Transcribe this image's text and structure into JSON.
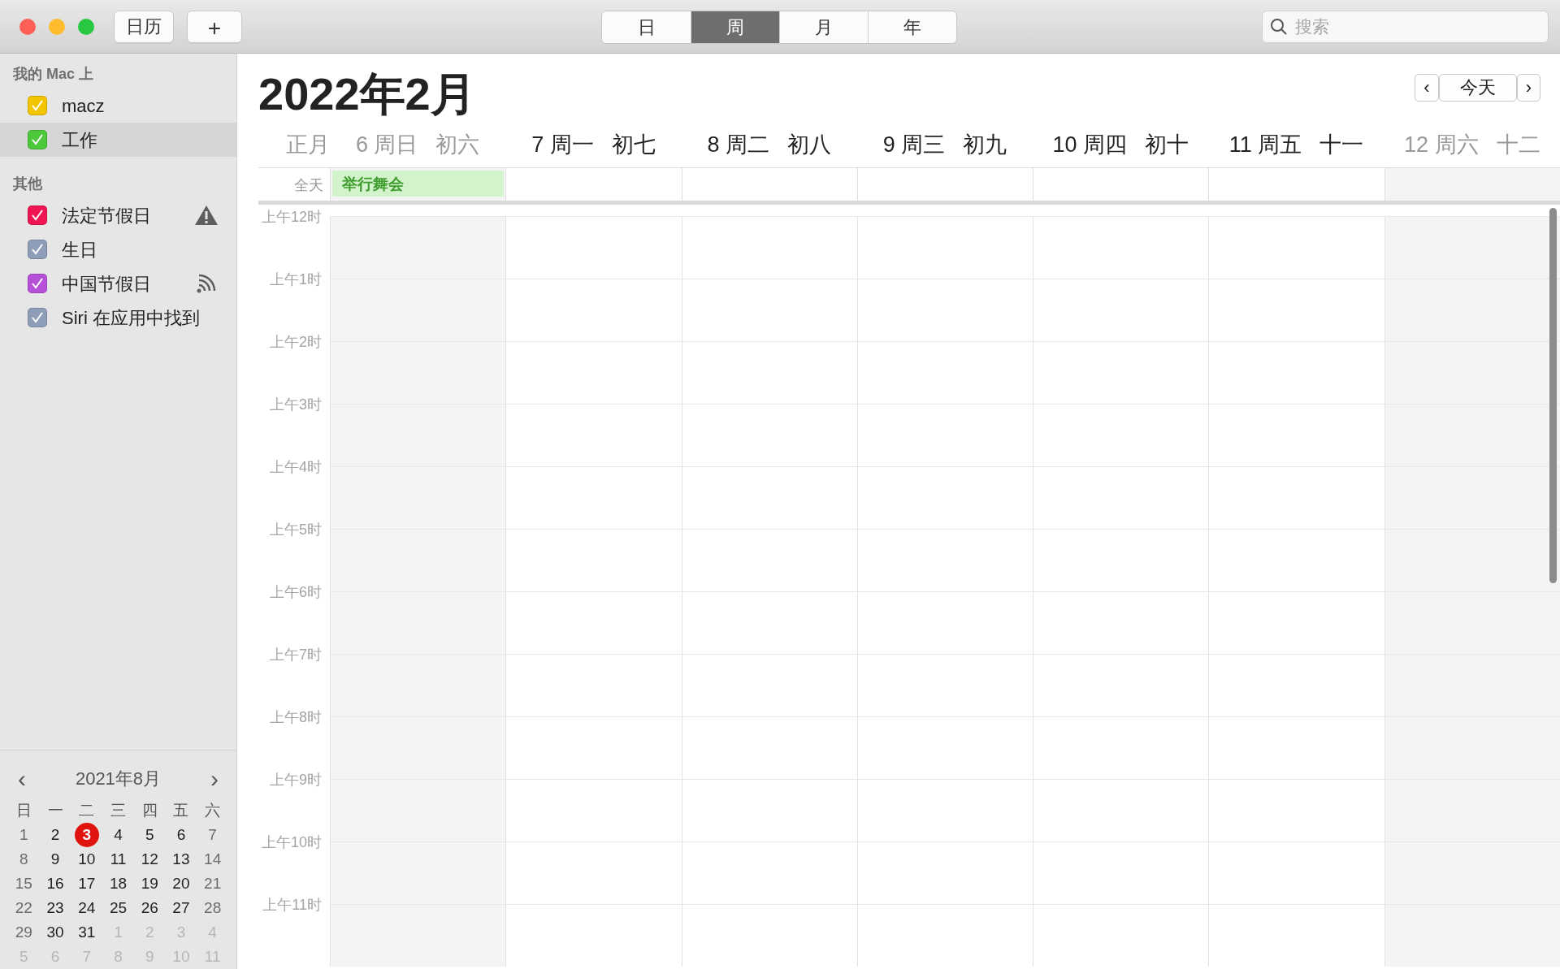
{
  "toolbar": {
    "calendars_button": "日历",
    "add_button": "+",
    "views": [
      {
        "label": "日",
        "selected": false
      },
      {
        "label": "周",
        "selected": true
      },
      {
        "label": "月",
        "selected": false
      },
      {
        "label": "年",
        "selected": false
      }
    ],
    "search": {
      "placeholder": "搜索"
    }
  },
  "sidebar": {
    "groups": [
      {
        "title": "我的 Mac 上",
        "items": [
          {
            "name": "macz",
            "color": "#f2c500",
            "checked": true,
            "selected": false,
            "alert": false,
            "subscribed": false
          },
          {
            "name": "工作",
            "color": "#4cc83a",
            "checked": true,
            "selected": true,
            "alert": false,
            "subscribed": false
          }
        ]
      },
      {
        "title": "其他",
        "items": [
          {
            "name": "法定节假日",
            "color": "#ef1552",
            "checked": true,
            "selected": false,
            "alert": true,
            "subscribed": false
          },
          {
            "name": "生日",
            "color": "#8e9db8",
            "checked": true,
            "selected": false,
            "alert": false,
            "subscribed": false
          },
          {
            "name": "中国节假日",
            "color": "#b650d8",
            "checked": true,
            "selected": false,
            "alert": false,
            "subscribed": true
          },
          {
            "name": "Siri 在应用中找到",
            "color": "#8e9db8",
            "checked": true,
            "selected": false,
            "alert": false,
            "subscribed": false
          }
        ]
      }
    ]
  },
  "mini_calendar": {
    "prev": "‹",
    "title": "2021年8月",
    "next": "›",
    "weekdays": [
      "日",
      "一",
      "二",
      "三",
      "四",
      "五",
      "六"
    ],
    "weeks": [
      [
        {
          "day": "1",
          "other_month": false,
          "today": false
        },
        {
          "day": "2",
          "other_month": false,
          "today": false
        },
        {
          "day": "3",
          "other_month": false,
          "today": true
        },
        {
          "day": "4",
          "other_month": false,
          "today": false
        },
        {
          "day": "5",
          "other_month": false,
          "today": false
        },
        {
          "day": "6",
          "other_month": false,
          "today": false
        },
        {
          "day": "7",
          "other_month": false,
          "today": false
        }
      ],
      [
        {
          "day": "8",
          "other_month": false,
          "today": false
        },
        {
          "day": "9",
          "other_month": false,
          "today": false
        },
        {
          "day": "10",
          "other_month": false,
          "today": false
        },
        {
          "day": "11",
          "other_month": false,
          "today": false
        },
        {
          "day": "12",
          "other_month": false,
          "today": false
        },
        {
          "day": "13",
          "other_month": false,
          "today": false
        },
        {
          "day": "14",
          "other_month": false,
          "today": false
        }
      ],
      [
        {
          "day": "15",
          "other_month": false,
          "today": false
        },
        {
          "day": "16",
          "other_month": false,
          "today": false
        },
        {
          "day": "17",
          "other_month": false,
          "today": false
        },
        {
          "day": "18",
          "other_month": false,
          "today": false
        },
        {
          "day": "19",
          "other_month": false,
          "today": false
        },
        {
          "day": "20",
          "other_month": false,
          "today": false
        },
        {
          "day": "21",
          "other_month": false,
          "today": false
        }
      ],
      [
        {
          "day": "22",
          "other_month": false,
          "today": false
        },
        {
          "day": "23",
          "other_month": false,
          "today": false
        },
        {
          "day": "24",
          "other_month": false,
          "today": false
        },
        {
          "day": "25",
          "other_month": false,
          "today": false
        },
        {
          "day": "26",
          "other_month": false,
          "today": false
        },
        {
          "day": "27",
          "other_month": false,
          "today": false
        },
        {
          "day": "28",
          "other_month": false,
          "today": false
        }
      ],
      [
        {
          "day": "29",
          "other_month": false,
          "today": false
        },
        {
          "day": "30",
          "other_month": false,
          "today": false
        },
        {
          "day": "31",
          "other_month": false,
          "today": false
        },
        {
          "day": "1",
          "other_month": true,
          "today": false
        },
        {
          "day": "2",
          "other_month": true,
          "today": false
        },
        {
          "day": "3",
          "other_month": true,
          "today": false
        },
        {
          "day": "4",
          "other_month": true,
          "today": false
        }
      ],
      [
        {
          "day": "5",
          "other_month": true,
          "today": false
        },
        {
          "day": "6",
          "other_month": true,
          "today": false
        },
        {
          "day": "7",
          "other_month": true,
          "today": false
        },
        {
          "day": "8",
          "other_month": true,
          "today": false
        },
        {
          "day": "9",
          "other_month": true,
          "today": false
        },
        {
          "day": "10",
          "other_month": true,
          "today": false
        },
        {
          "day": "11",
          "other_month": true,
          "today": false
        }
      ]
    ]
  },
  "week_view": {
    "title": "2022年2月",
    "prev": "‹",
    "today_button": "今天",
    "next": "›",
    "lunar_month": "正月",
    "all_day_label": "全天",
    "days": [
      {
        "date": "6",
        "weekday": "周日",
        "lunar": "初六",
        "weekend": true,
        "all_day_events": [
          "举行舞会"
        ]
      },
      {
        "date": "7",
        "weekday": "周一",
        "lunar": "初七",
        "weekend": false
      },
      {
        "date": "8",
        "weekday": "周二",
        "lunar": "初八",
        "weekend": false
      },
      {
        "date": "9",
        "weekday": "周三",
        "lunar": "初九",
        "weekend": false
      },
      {
        "date": "10",
        "weekday": "周四",
        "lunar": "初十",
        "weekend": false
      },
      {
        "date": "11",
        "weekday": "周五",
        "lunar": "十一",
        "weekend": false
      },
      {
        "date": "12",
        "weekday": "周六",
        "lunar": "十二",
        "weekend": true
      }
    ],
    "hours": [
      "上午12时",
      "上午1时",
      "上午2时",
      "上午3时",
      "上午4时",
      "上午5时",
      "上午6时",
      "上午7时",
      "上午8时",
      "上午9时",
      "上午10时",
      "上午11时"
    ]
  }
}
